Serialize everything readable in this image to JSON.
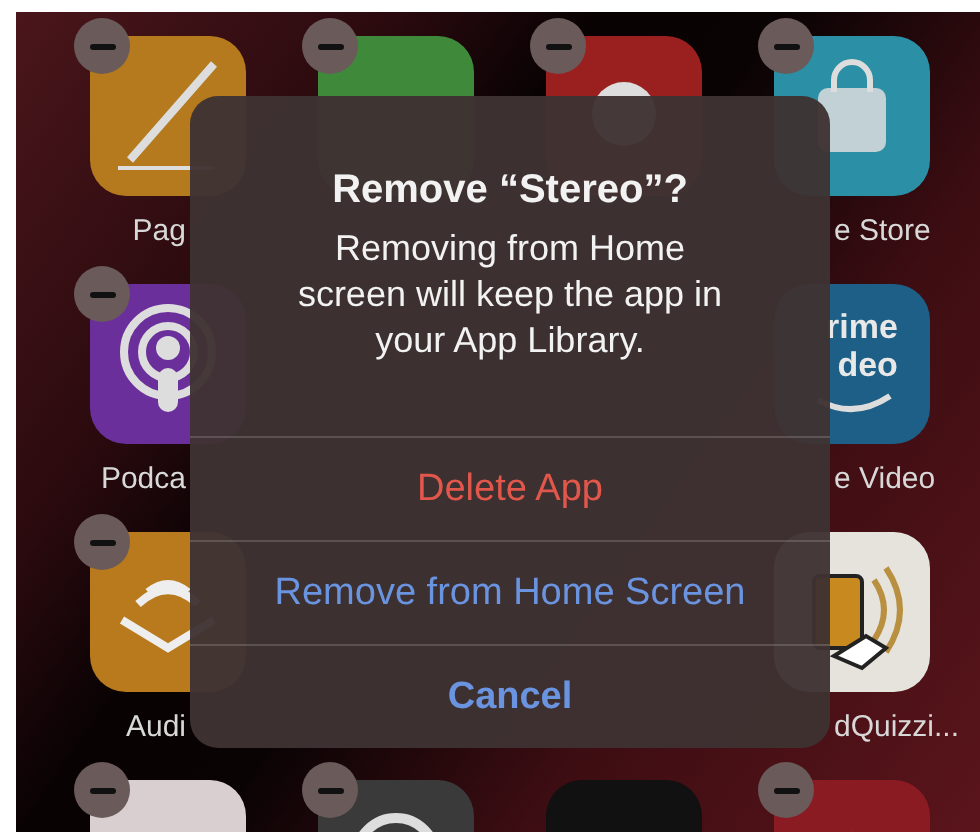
{
  "home_screen": {
    "rows": [
      {
        "apps": [
          {
            "kind": "pencil",
            "label": "Pag",
            "badge": true
          },
          {
            "kind": "plain-green",
            "badge": true
          },
          {
            "kind": "circle",
            "badge": true
          },
          {
            "kind": "bag",
            "label": "e Store",
            "badge": true
          }
        ]
      },
      {
        "apps": [
          {
            "kind": "podcast",
            "label": "Podca",
            "badge": true
          },
          {
            "kind": "prime",
            "logo_lines": [
              "rime",
              "deo"
            ],
            "label": "e Video"
          }
        ]
      },
      {
        "apps": [
          {
            "kind": "book",
            "label": "Audi",
            "badge": true
          },
          {
            "kind": "tablet",
            "label": "dQuizzi..."
          }
        ]
      },
      {
        "apps": [
          {
            "kind": "swirl",
            "badge": true
          },
          {
            "kind": "ring",
            "badge": true
          },
          {
            "kind": "dark"
          },
          {
            "kind": "chevron",
            "badge": true
          }
        ]
      }
    ]
  },
  "alert": {
    "title": "Remove “Stereo”?",
    "message": "Removing from Home\nscreen will keep the app in\nyour App Library.",
    "buttons": [
      {
        "label": "Delete App",
        "kind": "destructive"
      },
      {
        "label": "Remove from Home Screen",
        "kind": "default"
      },
      {
        "label": "Cancel",
        "kind": "cancel"
      }
    ]
  }
}
